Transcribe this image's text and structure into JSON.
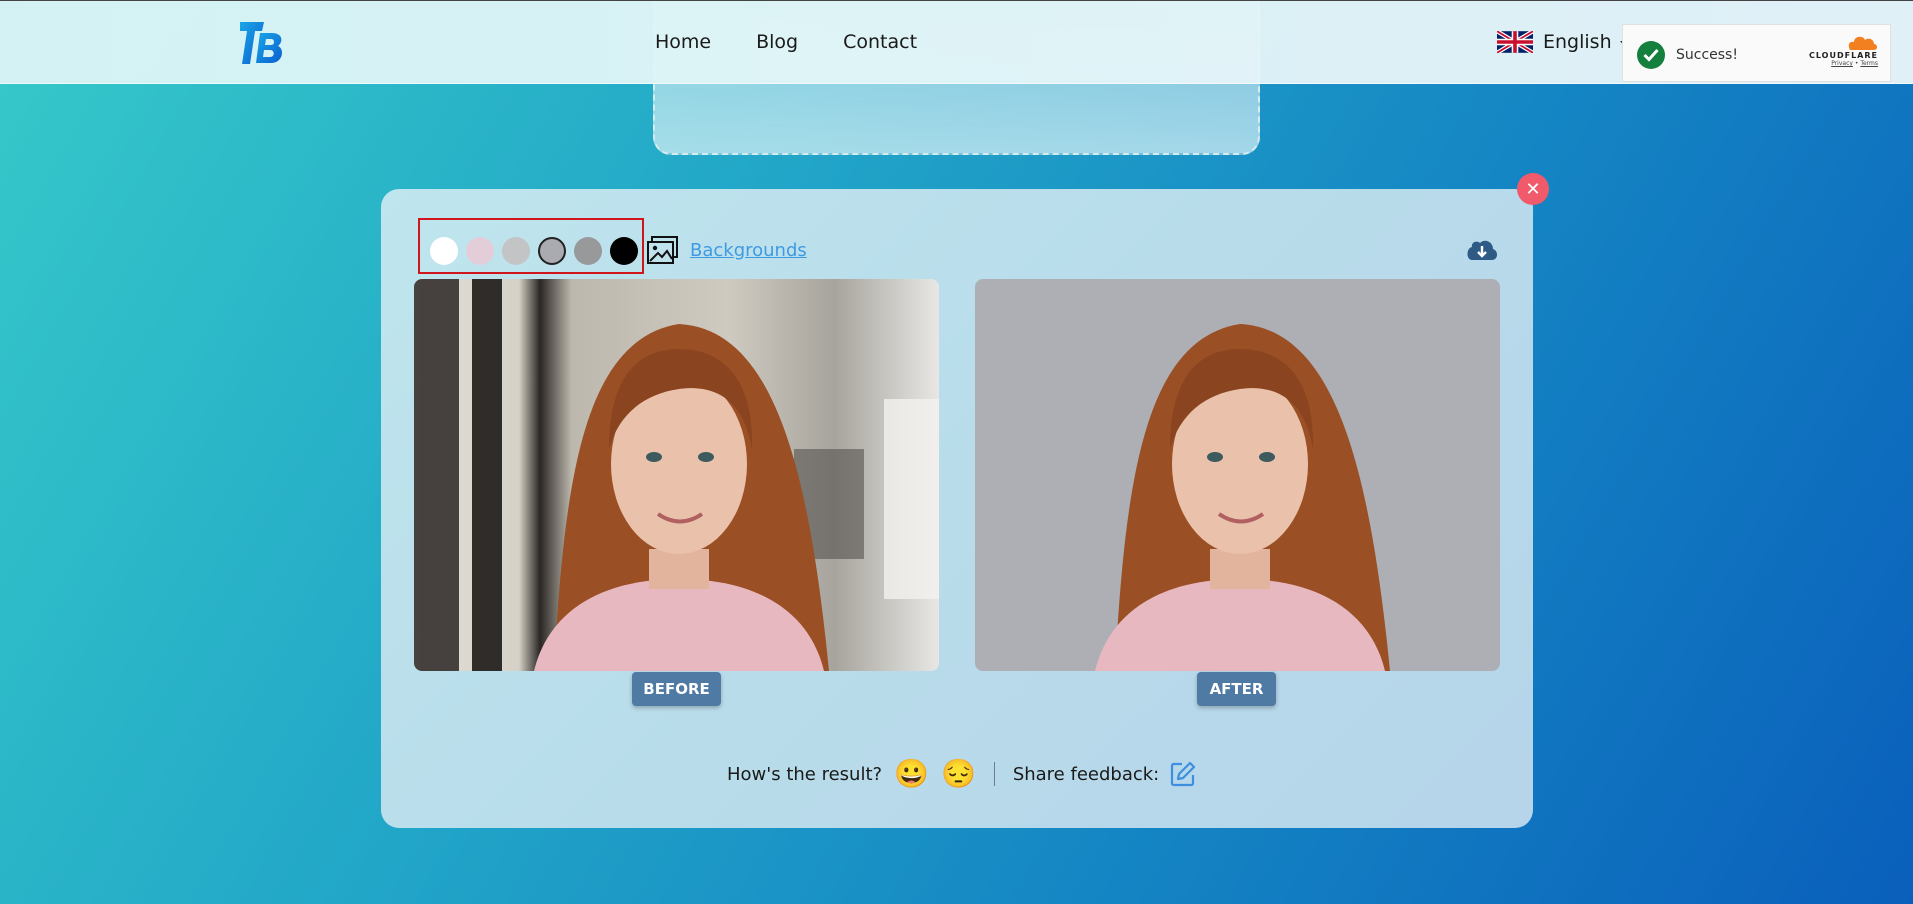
{
  "header": {
    "nav": [
      "Home",
      "Blog",
      "Contact"
    ],
    "language": "English"
  },
  "cloudflare": {
    "status": "Success!",
    "brand": "CLOUDFLARE",
    "privacy": "Privacy",
    "terms": "Terms",
    "separator": "•"
  },
  "toolbar": {
    "swatches": [
      "#ffffff",
      "#e3cdd8",
      "#c3c4c6",
      "#a9abb0",
      "#98999b",
      "#000000"
    ],
    "selected_swatch": 3,
    "backgrounds_label": "Backgrounds"
  },
  "panels": {
    "before_label": "BEFORE",
    "after_label": "AFTER"
  },
  "feedback": {
    "question": "How's the result?",
    "happy_emoji": "😀",
    "sad_emoji": "😔",
    "share_label": "Share feedback:"
  },
  "colors": {
    "accent": "#3f9ae0",
    "close": "#f05a6a",
    "badge": "#4e7aa3",
    "highlight": "#d0151d"
  }
}
